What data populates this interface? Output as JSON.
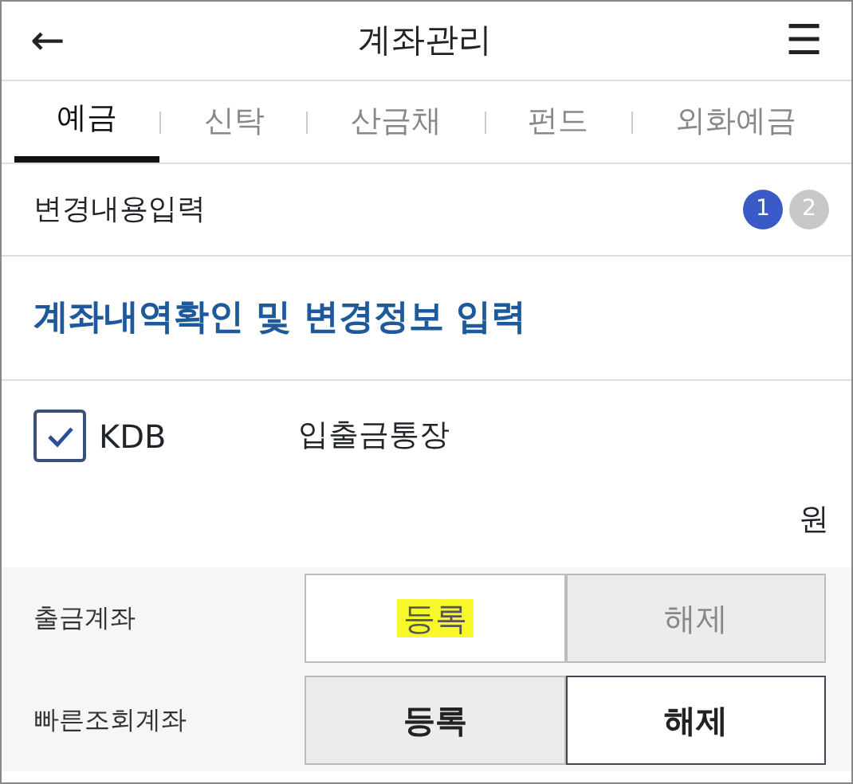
{
  "header": {
    "back": "←",
    "title": "계좌관리",
    "menu": "☰"
  },
  "tabs": [
    {
      "label": "예금",
      "selected": true
    },
    {
      "label": "신탁",
      "selected": false
    },
    {
      "label": "산금채",
      "selected": false
    },
    {
      "label": "펀드",
      "selected": false
    },
    {
      "label": "외화예금",
      "selected": false
    }
  ],
  "step_bar": {
    "label": "변경내용입력",
    "steps": [
      {
        "label": "1",
        "selected": true
      },
      {
        "label": "2",
        "selected": false
      }
    ]
  },
  "section_title": "계좌내역확인 및 변경정보 입력",
  "account": {
    "checked": true,
    "bank": "KDB",
    "product": "입출금통장",
    "currency": "원"
  },
  "settings": [
    {
      "label": "출금계좌",
      "disabled": true,
      "options": [
        {
          "label": "등록",
          "selected": true,
          "highlighted": true
        },
        {
          "label": "해제",
          "selected": false,
          "highlighted": false
        }
      ]
    },
    {
      "label": "빠른조회계좌",
      "disabled": false,
      "options": [
        {
          "label": "등록",
          "selected": false,
          "highlighted": false
        },
        {
          "label": "해제",
          "selected": true,
          "highlighted": false
        }
      ]
    }
  ]
}
